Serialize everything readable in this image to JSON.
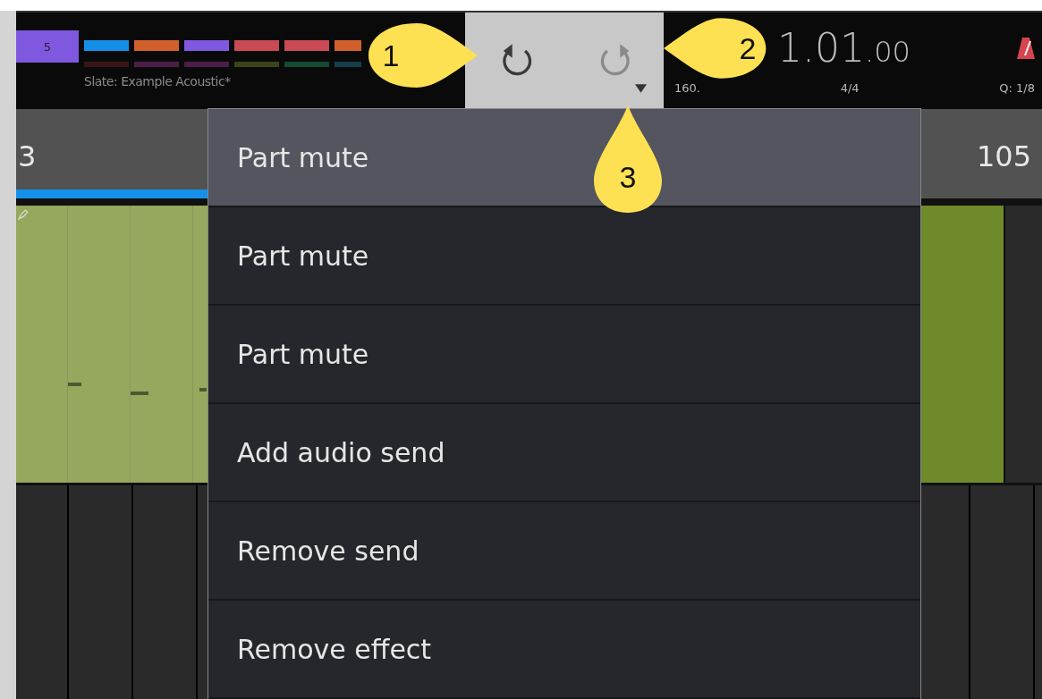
{
  "top_bar": {
    "slate_badge": "5",
    "track_slots": [
      {
        "color": "#1590e8"
      },
      {
        "color": "#d2602d"
      },
      {
        "color": "#8058e0"
      },
      {
        "color": "#c94a55"
      },
      {
        "color": "#c94a55"
      },
      {
        "color": "#d2602d"
      }
    ],
    "slot_indicators": [
      {
        "color": "#3a1518"
      },
      {
        "color": "#4a1e48"
      },
      {
        "color": "#4a1e48"
      },
      {
        "color": "#3a4418"
      },
      {
        "color": "#154a30"
      },
      {
        "color": "#153e4a"
      }
    ],
    "slate_name": "Slate: Example Acoustic*",
    "history": {
      "undo": {
        "disabled": false
      },
      "redo": {
        "disabled": true
      }
    },
    "position": {
      "main": "1.01",
      "fraction": ".00"
    },
    "tempo": "160.",
    "time_signature": "4/4",
    "quantize": "Q: 1/8"
  },
  "ruler": {
    "left_label": "3",
    "right_label": "105"
  },
  "menu": {
    "items": [
      {
        "label": "Part mute",
        "selected": true
      },
      {
        "label": "Part mute",
        "selected": false
      },
      {
        "label": "Part mute",
        "selected": false
      },
      {
        "label": "Add audio send",
        "selected": false
      },
      {
        "label": "Remove send",
        "selected": false
      },
      {
        "label": "Remove effect",
        "selected": false
      }
    ]
  },
  "callouts": [
    {
      "number": "1",
      "kind": "right"
    },
    {
      "number": "2",
      "kind": "left"
    },
    {
      "number": "3",
      "kind": "up"
    }
  ]
}
